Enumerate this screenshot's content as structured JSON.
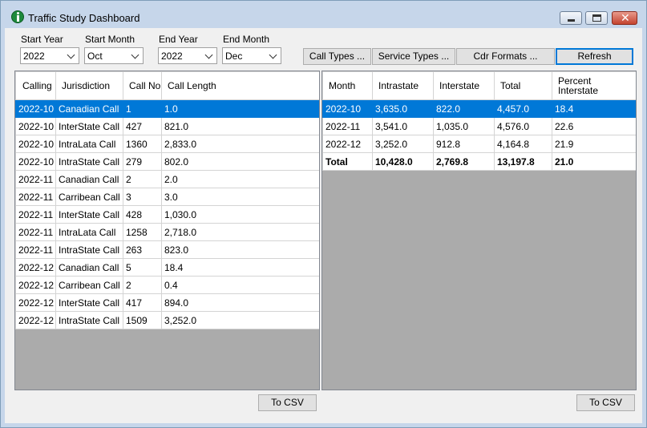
{
  "window": {
    "title": "Traffic Study Dashboard",
    "controls": {
      "minimize": "minimize-icon",
      "maximize": "maximize-icon",
      "close": "close-icon"
    }
  },
  "filters": {
    "start_year": {
      "label": "Start Year",
      "value": "2022"
    },
    "start_month": {
      "label": "Start Month",
      "value": "Oct"
    },
    "end_year": {
      "label": "End Year",
      "value": "2022"
    },
    "end_month": {
      "label": "End Month",
      "value": "Dec"
    }
  },
  "buttons": {
    "call_types": "Call Types ...",
    "service_types": "Service Types ...",
    "cdr_formats": "Cdr Formats ...",
    "refresh": "Refresh"
  },
  "left_grid": {
    "columns": [
      "Calling Period",
      "Jurisdiction",
      "Call No",
      "Call Length"
    ],
    "rows": [
      [
        "2022-10",
        "Canadian Call",
        "1",
        "1.0"
      ],
      [
        "2022-10",
        "InterState Call",
        "427",
        "821.0"
      ],
      [
        "2022-10",
        "IntraLata Call",
        "1360",
        "2,833.0"
      ],
      [
        "2022-10",
        "IntraState Call",
        "279",
        "802.0"
      ],
      [
        "2022-11",
        "Canadian Call",
        "2",
        "2.0"
      ],
      [
        "2022-11",
        "Carribean Call",
        "3",
        "3.0"
      ],
      [
        "2022-11",
        "InterState Call",
        "428",
        "1,030.0"
      ],
      [
        "2022-11",
        "IntraLata Call",
        "1258",
        "2,718.0"
      ],
      [
        "2022-11",
        "IntraState Call",
        "263",
        "823.0"
      ],
      [
        "2022-12",
        "Canadian Call",
        "5",
        "18.4"
      ],
      [
        "2022-12",
        "Carribean Call",
        "2",
        "0.4"
      ],
      [
        "2022-12",
        "InterState Call",
        "417",
        "894.0"
      ],
      [
        "2022-12",
        "IntraState Call",
        "1509",
        "3,252.0"
      ]
    ],
    "selected_row": 0,
    "csv_button": "To CSV"
  },
  "right_grid": {
    "columns": [
      "Month",
      "Intrastate",
      "Interstate",
      "Total",
      "Percent Interstate"
    ],
    "rows": [
      [
        "2022-10",
        "3,635.0",
        "822.0",
        "4,457.0",
        "18.4"
      ],
      [
        "2022-11",
        "3,541.0",
        "1,035.0",
        "4,576.0",
        "22.6"
      ],
      [
        "2022-12",
        "3,252.0",
        "912.8",
        "4,164.8",
        "21.9"
      ]
    ],
    "total_row": [
      "Total",
      "10,428.0",
      "2,769.8",
      "13,197.8",
      "21.0"
    ],
    "selected_row": 0,
    "csv_button": "To CSV"
  },
  "colors": {
    "selection": "#0078d7",
    "grid_background": "#ababab",
    "window_frame": "#c6d6ea"
  }
}
